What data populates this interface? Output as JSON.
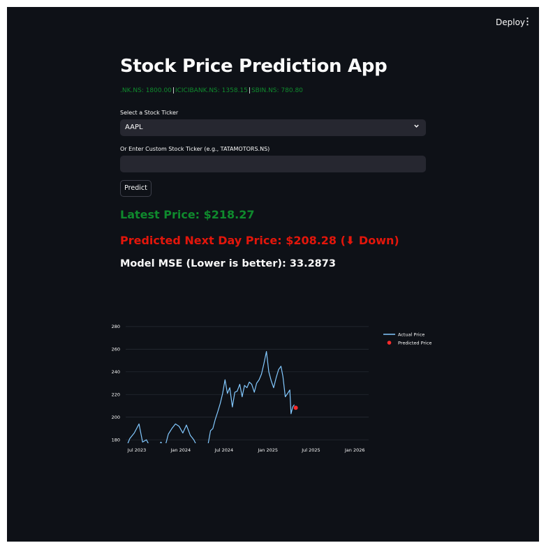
{
  "header": {
    "deploy_label": "Deploy",
    "menu_icon": "kebab-menu-icon"
  },
  "app": {
    "title": "Stock Price Prediction App",
    "tickers": [
      {
        "text": ".NK.NS: 1800.00"
      },
      {
        "text": "ICICIBANK.NS: 1358.15"
      },
      {
        "text": "SBIN.NS: 780.80"
      }
    ],
    "select_label": "Select a Stock Ticker",
    "select_value": "AAPL",
    "custom_label": "Or Enter Custom Stock Ticker (e.g., TATAMOTORS.NS)",
    "custom_value": "",
    "predict_button": "Predict",
    "latest_price": "Latest Price: $218.27",
    "predicted_price": "Predicted Next Day Price: $208.28 (⬇ Down)",
    "mse": "Model MSE (Lower is better): 33.2873"
  },
  "colors": {
    "up": "#0f8a2d",
    "down": "#e3160b",
    "line": "#83c9ff",
    "predicted": "#ff2b2b"
  },
  "chart_data": {
    "type": "line",
    "x_ticks": [
      "Jul 2023",
      "Jan 2024",
      "Jul 2024",
      "Jan 2025",
      "Jul 2025",
      "Jan 2026"
    ],
    "y_ticks": [
      180,
      200,
      220,
      240,
      260,
      280
    ],
    "ylim": [
      177,
      283
    ],
    "xlim": [
      "2023-05-15",
      "2026-02-28"
    ],
    "grid": true,
    "legend_position": "right",
    "series": [
      {
        "name": "Actual Price",
        "x": [
          "2023-05-15",
          "2023-06-01",
          "2023-06-20",
          "2023-07-10",
          "2023-07-25",
          "2023-08-10",
          "2023-08-25",
          "2023-09-10",
          "2023-09-25",
          "2023-10-10",
          "2023-10-25",
          "2023-11-10",
          "2023-11-25",
          "2023-12-10",
          "2023-12-25",
          "2024-01-10",
          "2024-01-25",
          "2024-02-10",
          "2024-02-25",
          "2024-03-10",
          "2024-03-25",
          "2024-04-10",
          "2024-04-25",
          "2024-05-05",
          "2024-05-15",
          "2024-05-25",
          "2024-06-05",
          "2024-06-15",
          "2024-06-25",
          "2024-07-05",
          "2024-07-15",
          "2024-07-25",
          "2024-08-05",
          "2024-08-15",
          "2024-08-25",
          "2024-09-05",
          "2024-09-15",
          "2024-09-25",
          "2024-10-05",
          "2024-10-15",
          "2024-10-25",
          "2024-11-05",
          "2024-11-15",
          "2024-11-25",
          "2024-12-05",
          "2024-12-15",
          "2024-12-26",
          "2025-01-05",
          "2025-01-15",
          "2025-01-25",
          "2025-02-05",
          "2025-02-15",
          "2025-02-25",
          "2025-03-05",
          "2025-03-15",
          "2025-03-25",
          "2025-04-03",
          "2025-04-08",
          "2025-04-15",
          "2025-04-22"
        ],
        "y": [
          172,
          181,
          186,
          194,
          178,
          180,
          174,
          176,
          171,
          178,
          172,
          185,
          190,
          194,
          192,
          186,
          193,
          184,
          180,
          174,
          172,
          170,
          176,
          188,
          190,
          198,
          205,
          212,
          221,
          233,
          221,
          226,
          209,
          222,
          223,
          229,
          218,
          228,
          226,
          231,
          229,
          222,
          230,
          233,
          238,
          247,
          258,
          240,
          232,
          226,
          235,
          242,
          245,
          236,
          218,
          221,
          224,
          203,
          209,
          211
        ]
      },
      {
        "name": "Predicted Price",
        "x": [
          "2025-04-28"
        ],
        "y": [
          208.28
        ]
      }
    ]
  }
}
